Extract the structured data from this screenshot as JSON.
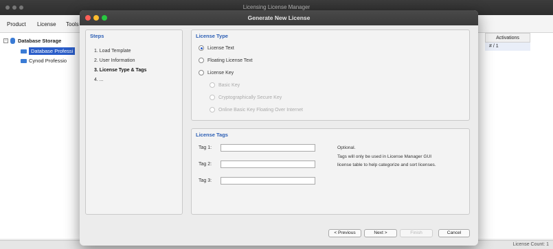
{
  "background": {
    "window_title": "Licensing License Manager",
    "menu": [
      "Product",
      "License",
      "Tools"
    ],
    "tree": {
      "root": "Database Storage",
      "items": [
        "Database Professi",
        "Cynod Professio"
      ]
    },
    "table": {
      "column_header": "Activations",
      "first_value": "# / 1"
    },
    "status": "License Count: 1"
  },
  "dialog": {
    "title": "Generate New License",
    "steps": {
      "header": "Steps",
      "items": [
        "1. Load Template",
        "2. User Information",
        "3. License Type & Tags",
        "4. ..."
      ]
    },
    "license_type": {
      "header": "License Type",
      "options": [
        "License Text",
        "Floating License Text",
        "License Key"
      ],
      "suboptions": [
        "Basic Key",
        "Cryptographically Secure Key",
        "Online Basic Key Floating Over Internet"
      ],
      "selected": "License Text"
    },
    "license_tags": {
      "header": "License Tags",
      "tags": [
        {
          "label": "Tag 1:",
          "value": ""
        },
        {
          "label": "Tag 2:",
          "value": ""
        },
        {
          "label": "Tag 3:",
          "value": ""
        }
      ],
      "note_title": "Optional.",
      "note_line1": "Tags will only be used in License Manager GUI",
      "note_line2": "license table to help categorize and sort licenses."
    },
    "buttons": {
      "previous": "< Previous",
      "next": "Next >",
      "finish": "Finish",
      "cancel": "Cancel"
    }
  },
  "colors": {
    "accent": "#2a5dc9",
    "header_text": "#2d5fb5",
    "close": "#ff5f57",
    "minimize": "#febc2e",
    "maximize": "#28c840"
  }
}
